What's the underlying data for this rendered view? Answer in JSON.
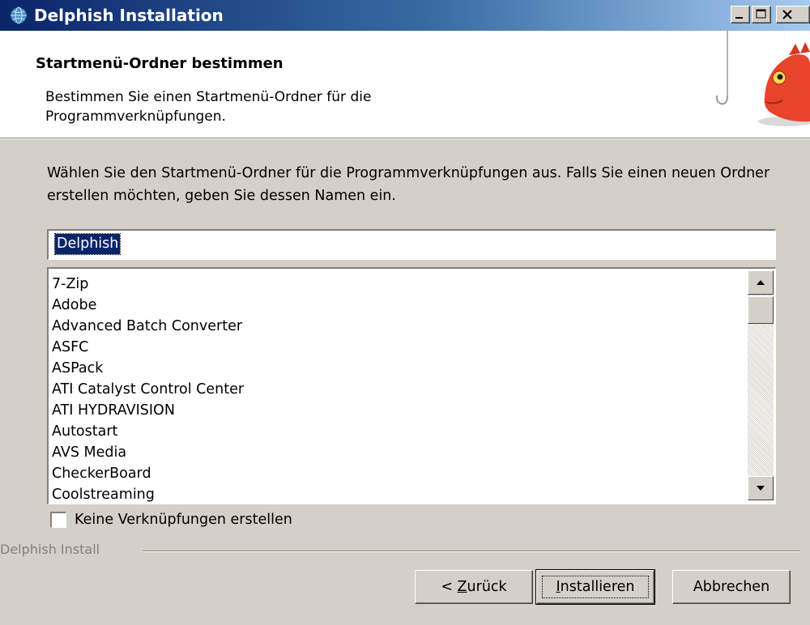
{
  "window": {
    "title": "Delphish Installation",
    "colors": {
      "title_start": "#0a246a",
      "title_end": "#a6caf0",
      "face": "#d4d0c8"
    }
  },
  "header": {
    "title": "Startmenü-Ordner bestimmen",
    "subtitle": "Bestimmen Sie einen Startmenü-Ordner für die Programmverknüpfungen."
  },
  "main": {
    "intro": "Wählen Sie den Startmenü-Ordner für die Programmverknüpfungen aus. Falls Sie einen neuen Ordner erstellen möchten, geben Sie dessen Namen ein.",
    "folder_value": "Delphish",
    "folders": [
      "7-Zip",
      "Adobe",
      "Advanced Batch Converter",
      "ASFC",
      "ASPack",
      "ATI Catalyst Control Center",
      "ATI HYDRAVISION",
      "Autostart",
      "AVS Media",
      "CheckerBoard",
      "Coolstreaming"
    ],
    "no_shortcuts_label": "Keine Verknüpfungen erstellen",
    "no_shortcuts_checked": false
  },
  "footer": {
    "group_label": "Delphish Install",
    "back_prefix": "< ",
    "back_accel": "Z",
    "back_rest": "urück",
    "install_accel": "I",
    "install_rest": "nstallieren",
    "cancel_label": "Abbrechen"
  }
}
